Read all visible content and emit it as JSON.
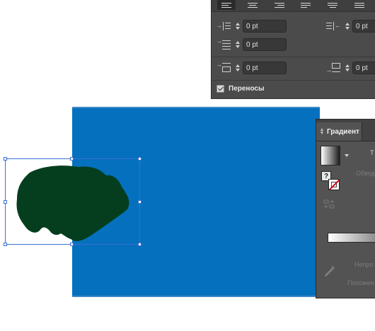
{
  "paragraph_panel": {
    "alignment_buttons": [
      "align-left",
      "align-center",
      "align-right",
      "justify-left",
      "justify-center",
      "justify-all"
    ],
    "left_indent": "0 pt",
    "right_indent": "0 pt",
    "first_line_indent": "0 pt",
    "space_before": "0 pt",
    "space_after": "0 pt",
    "hyphenate_label": "Переносы",
    "hyphenate_checked": true
  },
  "gradient_panel": {
    "title": "Градиент",
    "type_label": "Т",
    "stroke_label": "Обвод",
    "opacity_label": "Непро",
    "location_label": "Положен",
    "question_mark": "?"
  },
  "canvas": {
    "background_color": "#0570bd",
    "shape_color": "#043e1f"
  }
}
